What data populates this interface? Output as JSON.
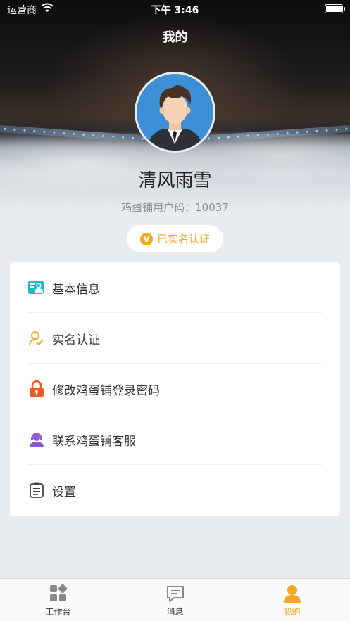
{
  "status_bar": {
    "carrier": "运营商",
    "time": "下午 3:46"
  },
  "header": {
    "title": "我的"
  },
  "profile": {
    "name": "清风雨雪",
    "user_code": "鸡蛋铺用户码：10037",
    "verify_badge": "已实名认证",
    "verify_badge_icon_text": "V"
  },
  "menu": {
    "items": [
      {
        "label": "基本信息",
        "icon": "id-card-icon"
      },
      {
        "label": "实名认证",
        "icon": "user-check-icon"
      },
      {
        "label": "修改鸡蛋铺登录密码",
        "icon": "lock-icon"
      },
      {
        "label": "联系鸡蛋铺客服",
        "icon": "customer-service-icon"
      },
      {
        "label": "设置",
        "icon": "settings-list-icon"
      }
    ]
  },
  "tab_bar": {
    "tabs": [
      {
        "label": "工作台",
        "icon": "workbench-icon",
        "active": false
      },
      {
        "label": "消息",
        "icon": "message-icon",
        "active": false
      },
      {
        "label": "我的",
        "icon": "profile-icon",
        "active": true
      }
    ]
  },
  "colors": {
    "accent": "#f5a623",
    "teal": "#1fbcc4",
    "lock": "#f15a29",
    "purple": "#8e5bd6"
  }
}
